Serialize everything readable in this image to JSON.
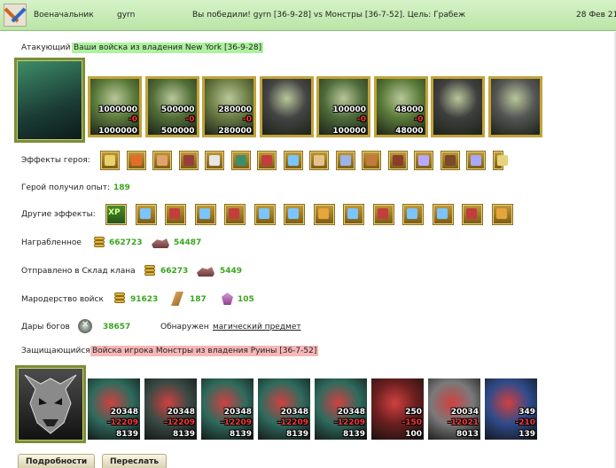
{
  "header": {
    "role": "Военачальник",
    "player": "gyrn",
    "result": "Вы победили! gyrn [36-9-28] vs Монстры [36-7-52]. Цель: Грабеж",
    "date": "28 Фев 21"
  },
  "attacker": {
    "label": "Атакующий",
    "title": "Ваши войска из владения New York [36-9-28]",
    "units": [
      {
        "top": "1000000",
        "loss": "-0",
        "bottom": "1000000"
      },
      {
        "top": "500000",
        "loss": "-0",
        "bottom": "500000"
      },
      {
        "top": "280000",
        "loss": "-0",
        "bottom": "280000"
      },
      {
        "top": "",
        "loss": "",
        "bottom": ""
      },
      {
        "top": "100000",
        "loss": "-0",
        "bottom": "100000"
      },
      {
        "top": "48000",
        "loss": "-0",
        "bottom": "48000"
      },
      {
        "top": "",
        "loss": "",
        "bottom": ""
      },
      {
        "top": "",
        "loss": "",
        "bottom": ""
      }
    ]
  },
  "hero_effects": {
    "label": "Эффекты героя:",
    "icons": [
      "treasure-icon",
      "torch-icon",
      "flask-icon",
      "chest-icon",
      "dice-icon",
      "shield-icon",
      "shield-sword-icon",
      "sword-icon",
      "hands-icon",
      "glove-icon",
      "boots-icon",
      "armor-icon",
      "pentagram-icon",
      "belt-icon",
      "ring-icon",
      "arrow-right-icon"
    ],
    "colors": [
      "#e8d26b",
      "#e56b2a",
      "#e0a36a",
      "#9a3d3d",
      "#e6e6e6",
      "#3d8f6a",
      "#c33d3d",
      "#7ac4ff",
      "#e5c28a",
      "#9ab4e8",
      "#c27a3d",
      "#8a3d2a",
      "#b8a8ff",
      "#7a4a2a",
      "#a8a8ff",
      "#e7d27c"
    ]
  },
  "experience": {
    "label": "Герой получил опыт:",
    "value": "189"
  },
  "other_effects": {
    "label": "Другие эффекты:",
    "icons": [
      "xp-icon",
      "sword-icon",
      "axe-icon",
      "sword-icon",
      "axe-icon",
      "sword-icon",
      "sword-icon",
      "key-icon",
      "sword-icon",
      "axe-icon",
      "sword-icon",
      "sword-icon",
      "axe-icon",
      "key-icon"
    ],
    "xp_text": "XP",
    "colors": [
      "#3aa51f",
      "#7ac4ff",
      "#c33d3d",
      "#7ac4ff",
      "#c33d3d",
      "#7ac4ff",
      "#7ac4ff",
      "#e5a53a",
      "#7ac4ff",
      "#c33d3d",
      "#7ac4ff",
      "#7ac4ff",
      "#c33d3d",
      "#e5a53a"
    ]
  },
  "loot": {
    "label": "Награбленное",
    "gold": "662723",
    "ore": "54487"
  },
  "clan_storage": {
    "label": "Отправлено в Склад клана",
    "gold": "66273",
    "ore": "5449"
  },
  "marauding": {
    "label": "Мародерство войск",
    "gold": "91623",
    "wood": "187",
    "gem": "105"
  },
  "gods": {
    "label": "Дары богов",
    "value": "38657",
    "found_label": "Обнаружен",
    "found_link": "магический предмет"
  },
  "defender": {
    "label": "Защищающийся",
    "title": "Войска игрока Монстры из владения Руины [36-7-52]",
    "units": [
      {
        "top": "20348",
        "loss": "-12209",
        "bottom": "8139"
      },
      {
        "top": "20348",
        "loss": "-12209",
        "bottom": "8139"
      },
      {
        "top": "20348",
        "loss": "-12209",
        "bottom": "8139"
      },
      {
        "top": "20348",
        "loss": "-12209",
        "bottom": "8139"
      },
      {
        "top": "20348",
        "loss": "-12209",
        "bottom": "8139"
      },
      {
        "top": "250",
        "loss": "-150",
        "bottom": "100"
      },
      {
        "top": "20034",
        "loss": "-12021",
        "bottom": "8013"
      },
      {
        "top": "349",
        "loss": "-210",
        "bottom": "139"
      }
    ]
  },
  "buttons": {
    "details": "Подробности",
    "forward": "Переслать"
  },
  "colors": {
    "accent_green": "#3aa51f",
    "loss_red": "#ff3a3a",
    "header_bg": "#c4ebb2"
  }
}
